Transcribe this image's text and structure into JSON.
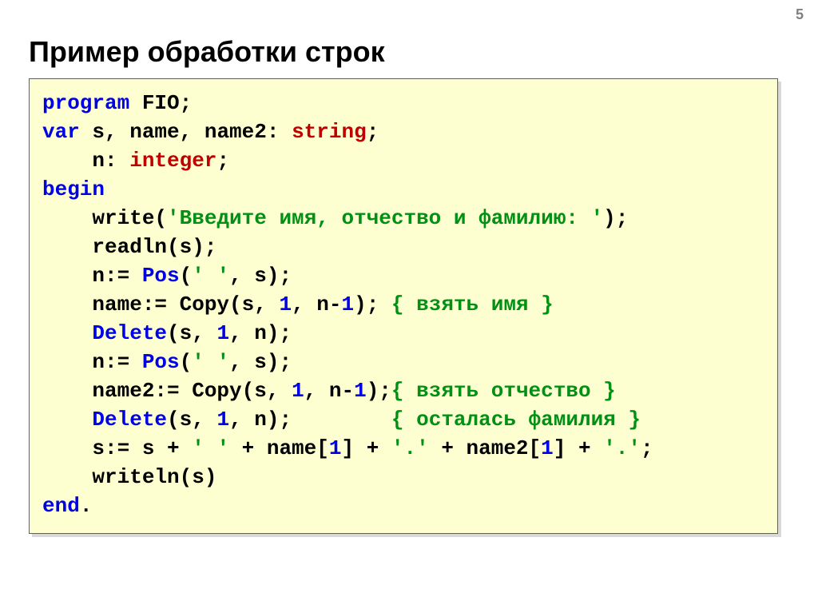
{
  "page_number": "5",
  "title": "Пример обработки строк",
  "code": {
    "l01_kw": "program",
    "l01_id": " FIO;",
    "l02_kw": "var",
    "l02_mid": " s, name, name2: ",
    "l02_typ": "string",
    "l02_end": ";",
    "l03_pre": "    n: ",
    "l03_typ": "integer",
    "l03_end": ";",
    "l04_kw": "begin",
    "l05_pre": "    write(",
    "l05_str": "'Введите имя, отчество и фамилию: '",
    "l05_end": ");",
    "l06": "    readln(s);",
    "l07_pre": "    n:= ",
    "l07_fn": "Pos",
    "l07_mid": "(",
    "l07_str": "' '",
    "l07_end": ", s);",
    "l08_pre": "    name:= Copy(s, ",
    "l08_n1": "1",
    "l08_mid": ", n-",
    "l08_n2": "1",
    "l08_close": "); ",
    "l08_cm": "{ взять имя }",
    "l09_pre": "    ",
    "l09_fn": "Delete",
    "l09_mid": "(s, ",
    "l09_n1": "1",
    "l09_end": ", n);",
    "l10_pre": "    n:= ",
    "l10_fn": "Pos",
    "l10_mid": "(",
    "l10_str": "' '",
    "l10_end": ", s);",
    "l11_pre": "    name2:= Copy(s, ",
    "l11_n1": "1",
    "l11_mid": ", n-",
    "l11_n2": "1",
    "l11_close": ");",
    "l11_cm": "{ взять отчество }",
    "l12_pre": "    ",
    "l12_fn": "Delete",
    "l12_mid": "(s, ",
    "l12_n1": "1",
    "l12_end": ", n);        ",
    "l12_cm": "{ осталась фамилия }",
    "l13_pre": "    s:= s + ",
    "l13_s1": "' '",
    "l13_m1": " + name[",
    "l13_n1": "1",
    "l13_m2": "] + ",
    "l13_s2": "'.'",
    "l13_m3": " + name2[",
    "l13_n2": "1",
    "l13_m4": "] + ",
    "l13_s3": "'.'",
    "l13_end": ";",
    "l14": "    writeln(s)",
    "l15_kw": "end",
    "l15_end": "."
  }
}
